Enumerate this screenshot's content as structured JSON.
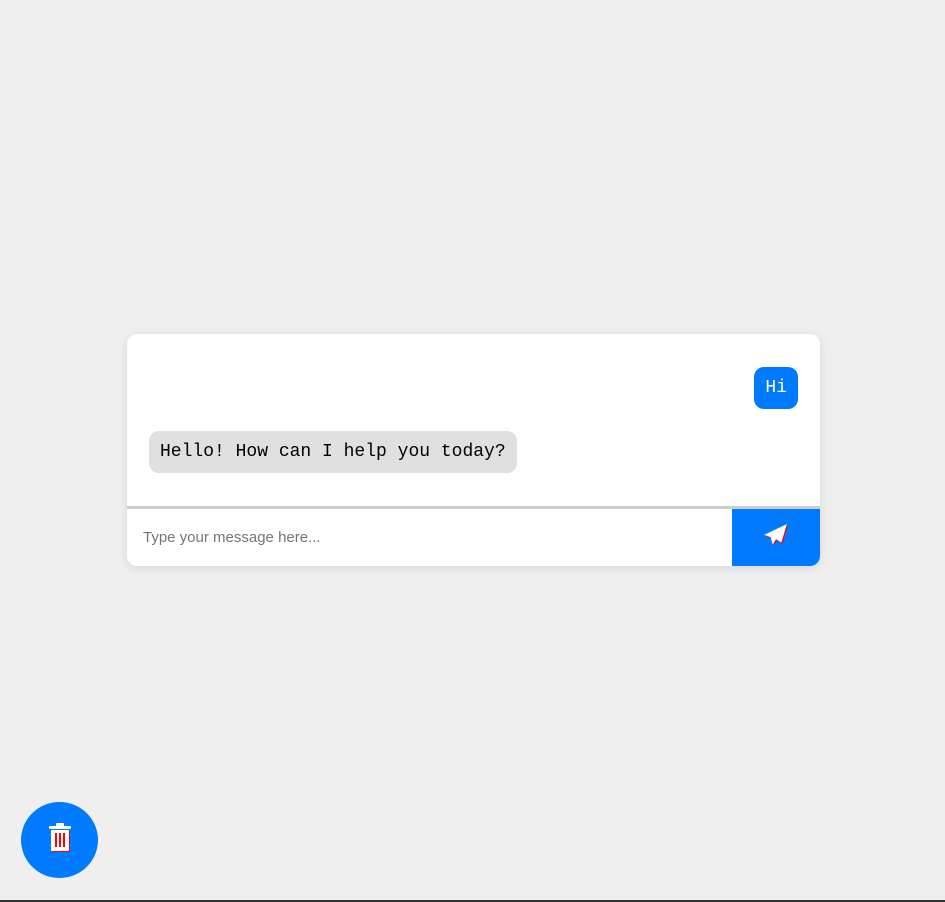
{
  "messages": [
    {
      "sender": "user",
      "text": "Hi"
    },
    {
      "sender": "bot",
      "text": "Hello! How can I help you today?"
    }
  ],
  "input": {
    "placeholder": "Type your message here...",
    "value": ""
  },
  "icons": {
    "send": "paper-plane-icon",
    "clear": "trash-icon"
  },
  "colors": {
    "accent": "#007bff",
    "bot_bubble": "#e0e0e0",
    "background": "#efefef"
  }
}
